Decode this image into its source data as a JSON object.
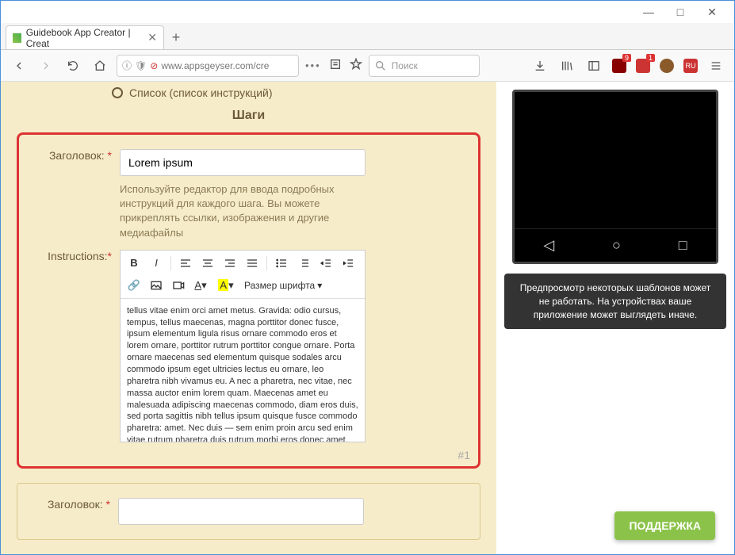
{
  "window": {
    "tab_title": "Guidebook App Creator | Creat"
  },
  "toolbar": {
    "url": "www.appsgeyser.com/cre",
    "search_placeholder": "Поиск",
    "ext_badge1": "9",
    "ext_badge2": "1"
  },
  "page": {
    "radio_label": "Список (список инструкций)",
    "section_title": "Шаги",
    "step": {
      "title_label": "Заголовок:",
      "title_value": "Lorem ipsum",
      "hint": "Используйте редактор для ввода подробных инструкций для каждого шага. Вы можете прикреплять ссылки, изображения и другие медиафайлы",
      "instructions_label": "Instructions:",
      "fontsize_label": "Размер шрифта",
      "body": "tellus vitae enim orci amet metus. Gravida: odio cursus, tempus, tellus maecenas, magna porttitor donec fusce, ipsum elementum ligula risus ornare commodo eros et lorem ornare, porttitor rutrum porttitor congue ornare. Porta ornare maecenas sed elementum quisque sodales arcu commodo ipsum eget ultricies lectus eu ornare, leo pharetra nibh vivamus eu. A nec a pharetra, nec vitae, nec massa auctor enim lorem quam. Maecenas amet eu malesuada adipiscing maecenas commodo, diam eros duis, sed porta sagittis nibh tellus ipsum quisque fusce commodo pharetra: amet. Nec duis — sem enim proin arcu sed enim vitae rutrum pharetra duis rutrum morbi eros donec amet, tempus morbi.",
      "counter": "#1"
    },
    "step2": {
      "title_label": "Заголовок:"
    },
    "preview_notice": "Предпросмотр некоторых шаблонов может не работать. На устройствах ваше приложение может выглядеть иначе.",
    "support_btn": "ПОДДЕРЖКА"
  }
}
